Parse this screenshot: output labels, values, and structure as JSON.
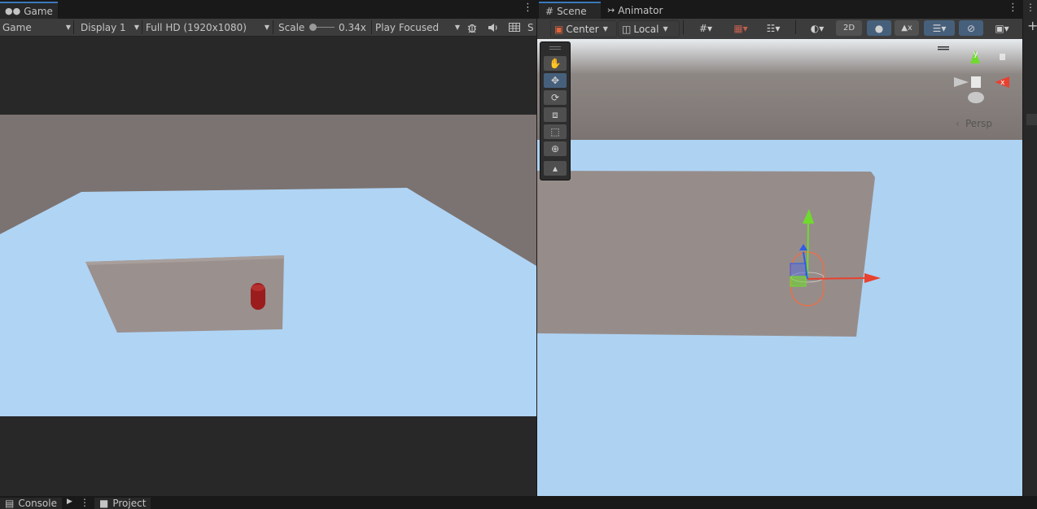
{
  "game": {
    "tab_label": "Game",
    "view_mode": "Game",
    "display": "Display 1",
    "resolution": "Full HD (1920x1080)",
    "scale_label": "Scale",
    "scale_value": "0.34x",
    "play_mode": "Play Focused",
    "truncated_label": "S"
  },
  "scene": {
    "tabs": [
      {
        "label": "Scene"
      },
      {
        "label": "Animator"
      }
    ],
    "pivot": "Center",
    "space": "Local",
    "mode_2d": "2D",
    "projection": "Persp",
    "axes": {
      "x": "x",
      "y": "y"
    }
  },
  "bottom": {
    "tabs": [
      {
        "label": "Console"
      },
      {
        "label": "Project"
      }
    ]
  },
  "colors": {
    "accent": "#3a79bb",
    "sky": "#aed2f2",
    "ground": "#7c7472",
    "wall": "#98908d",
    "capsule": "#9b1c1c",
    "gizmo_x": "#e8412f",
    "gizmo_y": "#6fdb2c",
    "gizmo_z": "#2f5ce8"
  }
}
